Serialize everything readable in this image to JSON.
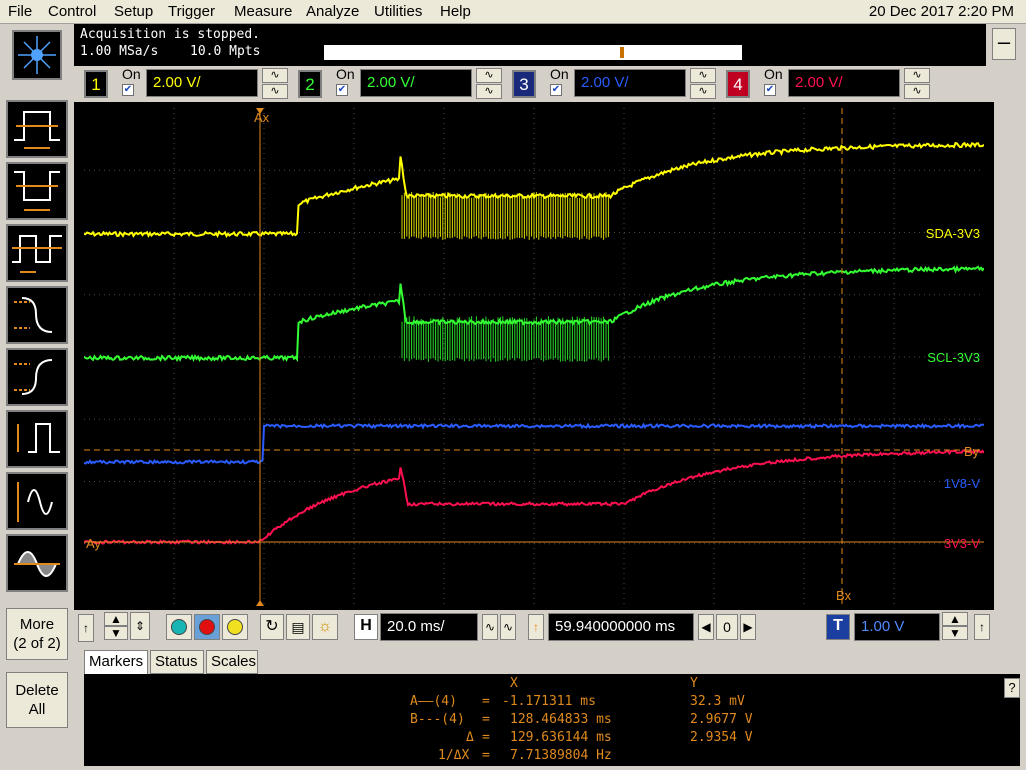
{
  "menu": {
    "items": [
      "File",
      "Control",
      "Setup",
      "Trigger",
      "Measure",
      "Analyze",
      "Utilities",
      "Help"
    ],
    "datetime": "20 Dec 2017  2:20 PM"
  },
  "acquisition": {
    "status": "Acquisition is stopped.",
    "sample_rate": "1.00 MSa/s",
    "memory_depth": "10.0 Mpts"
  },
  "channels": [
    {
      "number": "1",
      "on_label": "On",
      "checked": true,
      "scale": "2.00 V/",
      "color": "#ffff00"
    },
    {
      "number": "2",
      "on_label": "On",
      "checked": true,
      "scale": "2.00 V/",
      "color": "#33ff33"
    },
    {
      "number": "3",
      "on_label": "On",
      "checked": true,
      "scale": "2.00 V/",
      "color": "#2a5cff"
    },
    {
      "number": "4",
      "on_label": "On",
      "checked": true,
      "scale": "2.00 V/",
      "color": "#ff1050"
    }
  ],
  "waveform_labels": {
    "ch1": "SDA-3V3",
    "ch2": "SCL-3V3",
    "ch3": "1V8-V",
    "ch4": "3V3-V",
    "ch1_marker": "1",
    "ch2_marker": "2",
    "ch3_marker": "3",
    "ch4_marker": "4",
    "trigger_marker": "T",
    "ax": "Ax",
    "bx": "Bx",
    "ay": "Ay",
    "by": "By"
  },
  "side_buttons": {
    "more_line1": "More",
    "more_line2": "(2 of 2)",
    "delete_line1": "Delete",
    "delete_line2": "All"
  },
  "timebase": {
    "h_label": "H",
    "scale": "20.0 ms/",
    "delay": "59.940000000 ms",
    "delay_step": "0"
  },
  "trigger": {
    "t_label": "T",
    "level": "1.00 V"
  },
  "tabs": [
    "Markers",
    "Status",
    "Scales"
  ],
  "markers": {
    "header_x": "X",
    "header_y": "Y",
    "rows": [
      {
        "label": "A——(4)",
        "eq": "=",
        "x": "-1.171311 ms",
        "y": "32.3 mV"
      },
      {
        "label": "B---(4)",
        "eq": "=",
        "x": "128.464833 ms",
        "y": "2.9677 V"
      },
      {
        "label": "Δ",
        "eq": "=",
        "x": "129.636144 ms",
        "y": "2.9354 V"
      },
      {
        "label": "1/ΔX",
        "eq": "=",
        "x": "7.71389804 Hz",
        "y": ""
      }
    ]
  },
  "colors": {
    "ch1": "#ffff00",
    "ch2": "#33ff33",
    "ch3": "#2a5cff",
    "ch4": "#ff1050",
    "marker": "#e08a1e",
    "grid": "#4a4a4a"
  }
}
